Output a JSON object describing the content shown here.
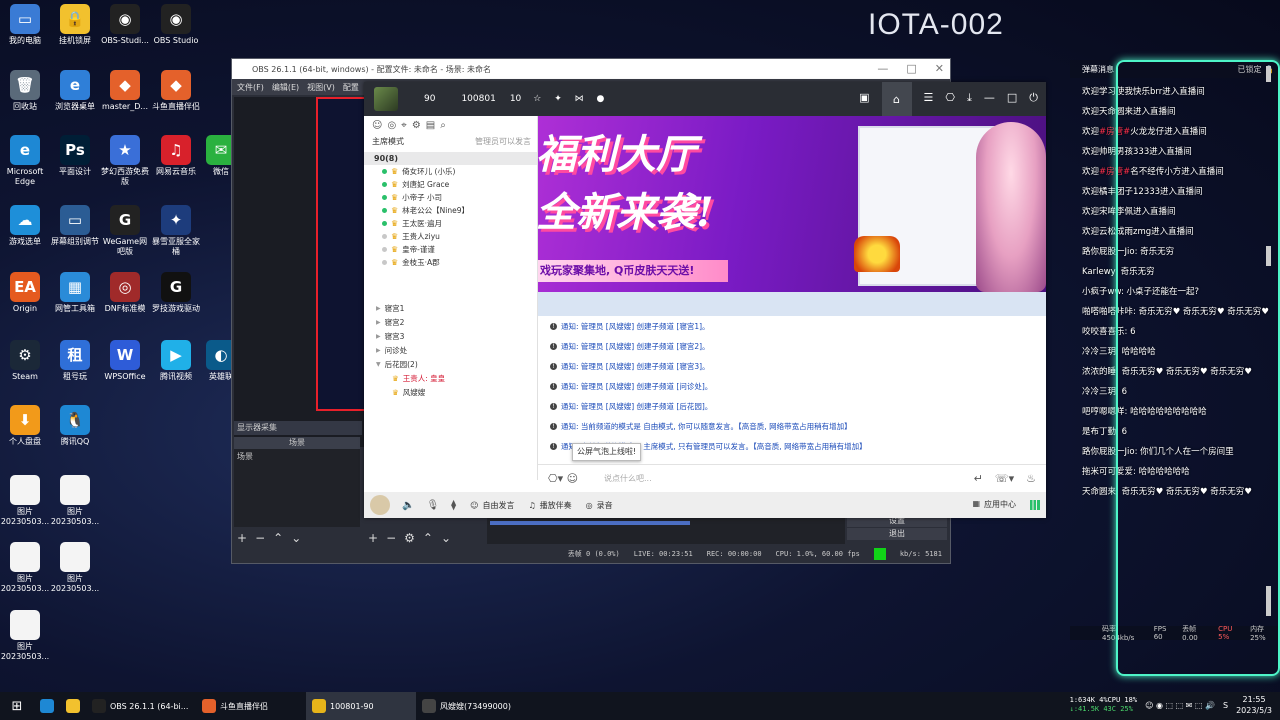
{
  "stream_title": "IOTA-002",
  "desktop": {
    "icons": [
      {
        "label": "我的电脑",
        "color": "#3a7bd5",
        "glyph": "▭"
      },
      {
        "label": "挂机锁屏",
        "color": "#f2c12e",
        "glyph": "🔒"
      },
      {
        "label": "OBS-Studi...",
        "color": "#222",
        "glyph": "◉"
      },
      {
        "label": "OBS Studio",
        "color": "#222",
        "glyph": "◉"
      },
      {
        "label": "回收站",
        "color": "#5a6a7a",
        "glyph": "🗑"
      },
      {
        "label": "浏览器桌单",
        "color": "#2f7fd8",
        "glyph": "e"
      },
      {
        "label": "master_D...",
        "color": "#e4612b",
        "glyph": "◆"
      },
      {
        "label": "斗鱼直播伴侣",
        "color": "#e4612b",
        "glyph": "◆"
      },
      {
        "label": "Microsoft Edge",
        "color": "#1e88d4",
        "glyph": "e"
      },
      {
        "label": "平面设计",
        "color": "#001e36",
        "glyph": "Ps"
      },
      {
        "label": "梦幻西游免费版",
        "color": "#3a6fd8",
        "glyph": "★"
      },
      {
        "label": "网易云音乐",
        "color": "#d8212b",
        "glyph": "♫"
      },
      {
        "label": "游戏选单",
        "color": "#1e8fd9",
        "glyph": "☁"
      },
      {
        "label": "屏幕组别调节",
        "color": "#2b5c94",
        "glyph": "▭"
      },
      {
        "label": "WeGame网吧版",
        "color": "#222",
        "glyph": "G"
      },
      {
        "label": "暴雪亚服全家桶",
        "color": "#1d3c7c",
        "glyph": "✦"
      },
      {
        "label": "Origin",
        "color": "#e55a1f",
        "glyph": "EA"
      },
      {
        "label": "网管工具箱",
        "color": "#2a8bd8",
        "glyph": "▦"
      },
      {
        "label": "DNF标准模",
        "color": "#a02a2a",
        "glyph": "◎"
      },
      {
        "label": "罗技游戏驱动",
        "color": "#111",
        "glyph": "G"
      },
      {
        "label": "Steam",
        "color": "#1b2838",
        "glyph": "⚙"
      },
      {
        "label": "租号玩",
        "color": "#2f6fd8",
        "glyph": "租"
      },
      {
        "label": "WPSOffice",
        "color": "#2e5cd8",
        "glyph": "W"
      },
      {
        "label": "腾讯视频",
        "color": "#20b0e8",
        "glyph": "▶"
      },
      {
        "label": "英雄联",
        "color": "#0a5a8a",
        "glyph": "◐"
      },
      {
        "label": "个人盘盘",
        "color": "#f29a1a",
        "glyph": "⬇"
      },
      {
        "label": "腾讯QQ",
        "color": "#1e88d4",
        "glyph": "🐧"
      },
      {
        "label": "图片 20230503...",
        "color": "#f4f4f4",
        "glyph": ""
      },
      {
        "label": "图片 20230503...",
        "color": "#f4f4f4",
        "glyph": ""
      },
      {
        "label": "图片 20230503...",
        "color": "#f4f4f4",
        "glyph": ""
      },
      {
        "label": "图片 20230503...",
        "color": "#f4f4f4",
        "glyph": ""
      },
      {
        "label": "图片 20230503...",
        "color": "#f4f4f4",
        "glyph": ""
      },
      {
        "label": "微信",
        "color": "#2ab13f",
        "glyph": "✉"
      }
    ]
  },
  "obs": {
    "title": "OBS 26.1.1 (64-bit, windows) - 配置文件: 未命名 - 场景: 未命名",
    "menu": [
      "文件(F)",
      "编辑(E)",
      "视图(V)",
      "配置"
    ],
    "sources_label": "显示器采集",
    "scenes_header": "场景",
    "scene_item": "场景",
    "status": {
      "dropped": "丢帧 0 (0.0%)",
      "live": "LIVE: 00:23:51",
      "rec": "REC: 00:00:00",
      "cpu": "CPU: 1.0%, 60.00 fps",
      "kbps": "kb/s: 5181"
    },
    "controls": [
      "设置",
      "退出"
    ]
  },
  "douyu": {
    "level": "90",
    "room_id": "100801",
    "fans": "10",
    "mode_label": "主席模式",
    "mode_hint": "管理员可以发言",
    "channel_head": "90(8)",
    "members": [
      {
        "name": "倚女环儿 (小乐)",
        "online": true
      },
      {
        "name": "刘唐妃 Grace",
        "online": true
      },
      {
        "name": "小帝子 小司",
        "online": true
      },
      {
        "name": "林老公公【Nine9】",
        "online": true
      },
      {
        "name": "王太医·遍月",
        "online": true
      },
      {
        "name": "王贵人ziyu",
        "online": false
      },
      {
        "name": "皇帝-谨谨",
        "online": false
      },
      {
        "name": "金枝玉·A郡",
        "online": false
      }
    ],
    "sub_channels": [
      "寝宫1",
      "寝宫2",
      "寝宫3",
      "问诊处",
      "后花园(2)"
    ],
    "garden_members": [
      "王贵人: 皇皇",
      "风嫂嫂"
    ],
    "banner": {
      "line1": "福利大厅",
      "line2": "全新来袭!",
      "strip": "戏玩家聚集地, Q币皮肤天天送!"
    },
    "notices": [
      "通知: 管理员 [风嫂嫂] 创建子频道 [寝宫1]。",
      "通知: 管理员 [风嫂嫂] 创建子频道 [寝宫2]。",
      "通知: 管理员 [风嫂嫂] 创建子频道 [寝宫3]。",
      "通知: 管理员 [风嫂嫂] 创建子频道 [问诊处]。",
      "通知: 管理员 [风嫂嫂] 创建子频道 [后花园]。",
      "通知: 当前频道的模式是 自由模式, 你可以随意发言。【高音质, 网络带宽占用稍有增加】",
      "通知: 当前频道的模式是 主席模式, 只有管理员可以发言。【高音质, 网络带宽占用稍有增加】"
    ],
    "tooltip": "公屏气泡上线啦!",
    "input_placeholder": "说点什么吧...",
    "bottom": {
      "free_speak": "自由发言",
      "music": "播放伴奏",
      "record": "录音",
      "app_center": "应用中心"
    }
  },
  "chat": {
    "title": "弹幕消息",
    "locked": "已锁定",
    "lines": [
      {
        "text": "欢迎学习使我快乐brr进入直播间"
      },
      {
        "text": "欢迎天命圆来进入直播间"
      },
      {
        "tag": "#房管#",
        "text": "欢迎",
        "rest": "火龙龙仔进入直播间"
      },
      {
        "text": "欢迎帅明男孩333进入直播间"
      },
      {
        "tag": "#房管#",
        "text": "欢迎",
        "rest": "名不经传小方进入直播间"
      },
      {
        "text": "欢迎橘丰团子12333进入直播间"
      },
      {
        "text": "欢迎宋哞李佩进入直播间"
      },
      {
        "text": "欢迎云松成雨zmg进入直播间"
      },
      {
        "text": "路你屁股一Jio: 奇乐无穷"
      },
      {
        "text": "Karlewy: 奇乐无穷"
      },
      {
        "text": "小疯子ww: 小桌子还能在一起?"
      },
      {
        "text": "啪嗒啪嗒咔咔: 奇乐无穷♥ 奇乐无穷♥ 奇乐无穷♥"
      },
      {
        "text": "咬咬喜喜乐: 6"
      },
      {
        "text": "冷冷三玥: 哈哈哈哈"
      },
      {
        "text": "浓浓的睡: 奇乐无穷♥ 奇乐无穷♥ 奇乐无穷♥"
      },
      {
        "text": "冷冷三玥: 6"
      },
      {
        "text": "吧哼嗯嗯咩: 哈哈哈哈哈哈哈哈哈"
      },
      {
        "text": "是布丁勤: 6"
      },
      {
        "text": "路你屁股一Jio: 你们几个人在一个房间里"
      },
      {
        "text": "拖米可可爱爱: 哈哈哈哈哈哈"
      },
      {
        "text": "天命圆来: 奇乐无穷♥ 奇乐无穷♥ 奇乐无穷♥"
      }
    ],
    "footer": {
      "net": "码率 4504kb/s",
      "fps": "FPS 60",
      "drop": "丢帧 0.00",
      "cpu": "CPU 5%",
      "mem": "内存 25%"
    }
  },
  "taskbar": {
    "items": [
      {
        "label": "OBS 26.1.1 (64-bi...",
        "color": "#222"
      },
      {
        "label": "斗鱼直播伴侣",
        "color": "#e4612b"
      },
      {
        "label": "100801-90",
        "color": "#e6b41a"
      },
      {
        "label": "风嫂嫂(73499000)",
        "color": "#444"
      }
    ],
    "net_up": "1:634K  4%CPU  18%",
    "net_down": "↓:41.5K  43C  25%",
    "time": "21:55",
    "date": "2023/5/3"
  }
}
